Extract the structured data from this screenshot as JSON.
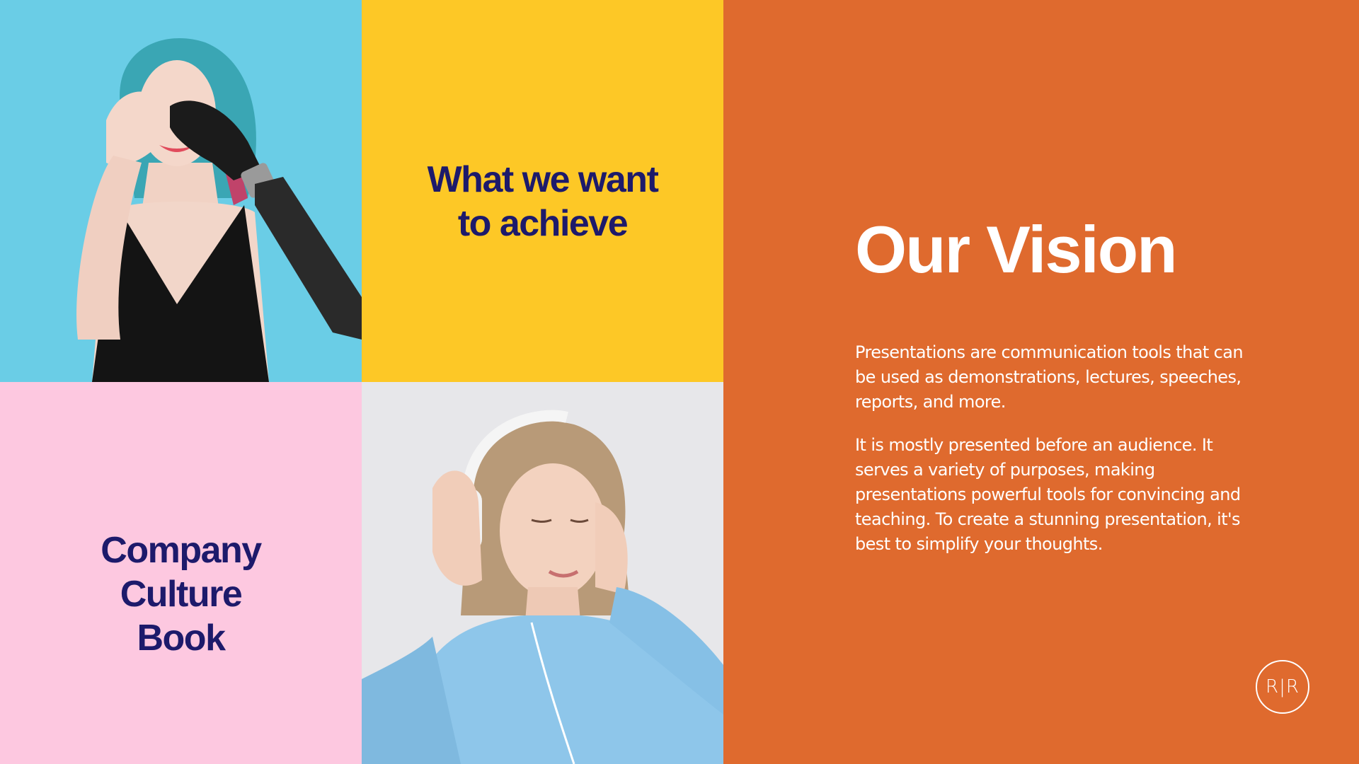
{
  "tiles": {
    "achieve_line1": "What we want",
    "achieve_line2": "to achieve",
    "culture_line1": "Company",
    "culture_line2": "Culture",
    "culture_line3": "Book"
  },
  "vision": {
    "title": "Our Vision",
    "paragraph_1": "Presentations are communication tools that can be used as demonstrations, lectures, speeches, reports, and more.",
    "paragraph_2": "It is mostly presented before an audience. It serves a variety of purposes, making presentations powerful tools for convincing and teaching. To create a stunning presentation, it's best to simplify your thoughts."
  },
  "logo": {
    "text": "R|R"
  },
  "colors": {
    "orange": "#df6a2e",
    "yellow": "#fdc826",
    "pink": "#fdc8e0",
    "sky": "#69cde5",
    "navy": "#1d1a6b"
  }
}
